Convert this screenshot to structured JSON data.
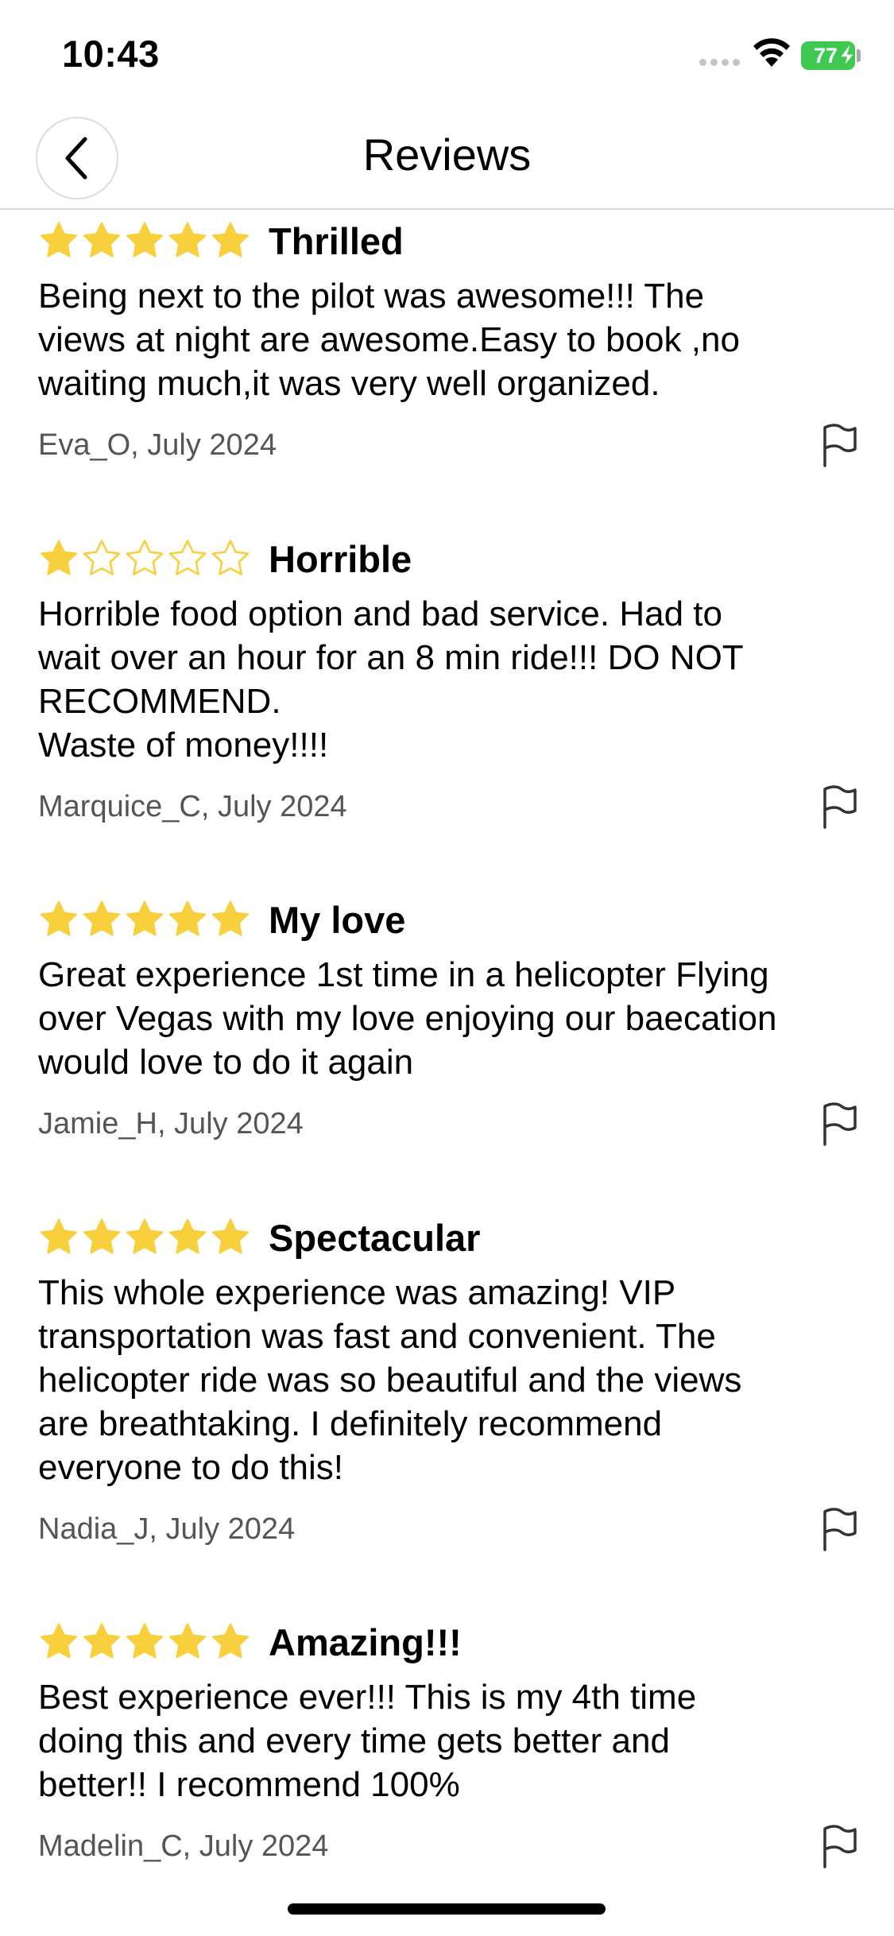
{
  "status_bar": {
    "time": "10:43",
    "battery": "77"
  },
  "nav": {
    "title": "Reviews"
  },
  "colors": {
    "star": "#f8cf3c",
    "battery": "#3fc950"
  },
  "reviews": [
    {
      "rating": 5,
      "title": "Thrilled",
      "body": "Being next to the pilot was awesome!!! The\nviews at night are awesome.Easy to book ,no\nwaiting much,it was very well organized.",
      "author": "Eva_O, July 2024"
    },
    {
      "rating": 1,
      "title": "Horrible",
      "body": "Horrible food option and bad service. Had to\nwait over an hour for an 8 min ride!!! DO NOT\nRECOMMEND.\nWaste of money!!!!",
      "author": "Marquice_C, July 2024"
    },
    {
      "rating": 5,
      "title": "My love",
      "body": "Great experience 1st time in a helicopter Flying\nover Vegas with my love enjoying our baecation\nwould love to do it again",
      "author": "Jamie_H, July 2024"
    },
    {
      "rating": 5,
      "title": "Spectacular",
      "body": "This whole experience was amazing! VIP\ntransportation was fast and convenient. The\nhelicopter ride was so beautiful and the views\nare breathtaking. I definitely recommend\neveryone to do this!",
      "author": "Nadia_J, July 2024"
    },
    {
      "rating": 5,
      "title": "Amazing!!!",
      "body": "Best experience ever!!! This is my 4th time\ndoing this and every time gets better and\nbetter!! I recommend 100%",
      "author": "Madelin_C, July 2024"
    }
  ]
}
